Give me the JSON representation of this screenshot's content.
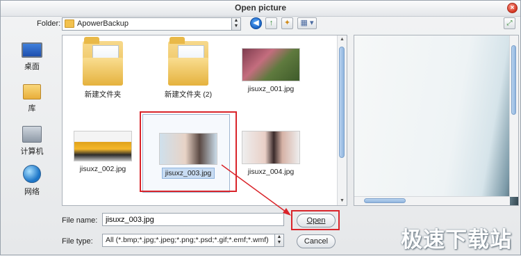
{
  "window": {
    "title": "Open picture"
  },
  "toolbar": {
    "folder_label": "Folder:",
    "folder_value": "ApowerBackup"
  },
  "places": [
    {
      "label": "桌面",
      "icon": "desktop-icon"
    },
    {
      "label": "库",
      "icon": "library-icon"
    },
    {
      "label": "计算机",
      "icon": "computer-icon"
    },
    {
      "label": "网络",
      "icon": "network-icon"
    }
  ],
  "files": [
    {
      "name": "新建文件夹",
      "type": "folder"
    },
    {
      "name": "新建文件夹 (2)",
      "type": "folder"
    },
    {
      "name": "jisuxz_001.jpg",
      "type": "image"
    },
    {
      "name": "jisuxz_002.jpg",
      "type": "image"
    },
    {
      "name": "jisuxz_003.jpg",
      "type": "image",
      "selected": true
    },
    {
      "name": "jisuxz_004.jpg",
      "type": "image"
    }
  ],
  "form": {
    "file_name_label": "File name:",
    "file_name_value": "jisuxz_003.jpg",
    "file_type_label": "File type:",
    "file_type_value": "All (*.bmp;*.jpg;*.jpeg;*.png;*.psd;*.gif;*.emf;*.wmf)",
    "open_label": "Open",
    "cancel_label": "Cancel"
  },
  "watermark": "极速下载站",
  "colors": {
    "highlight": "#d9242a",
    "selection": "#c8dcf3"
  }
}
